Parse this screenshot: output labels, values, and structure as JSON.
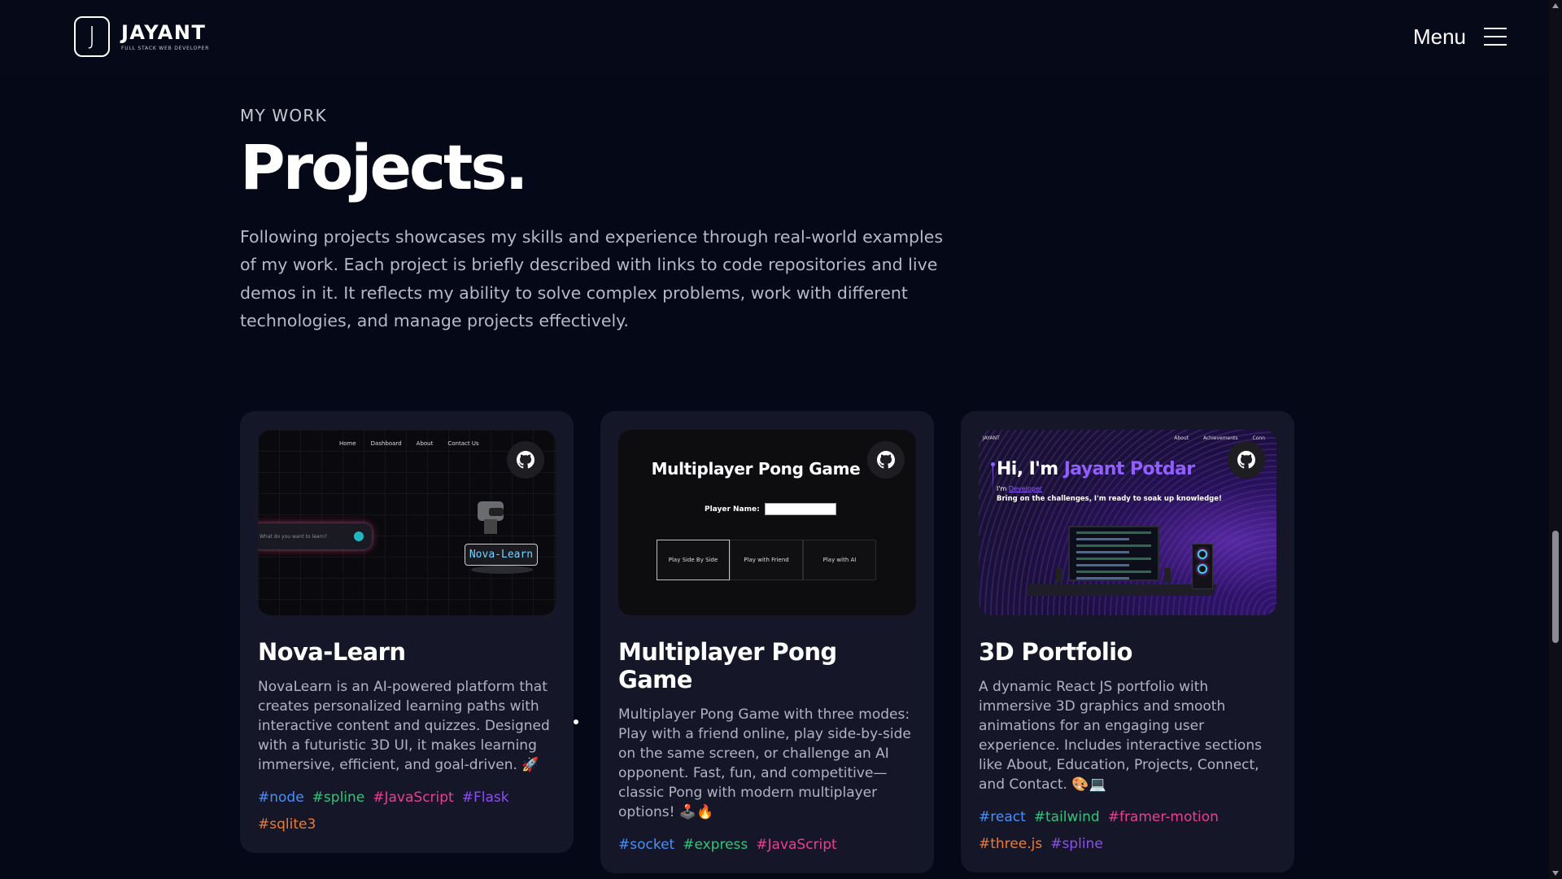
{
  "nav": {
    "logo_letter": "J",
    "brand_name": "JAYANT",
    "brand_tagline": "Full Stack Web Developer",
    "menu_label": "Menu"
  },
  "section": {
    "subtitle": "MY WORK",
    "title": "Projects.",
    "intro": "Following projects showcases my skills and experience through real-world examples of my work. Each project is briefly described with links to code repositories and live demos in it. It reflects my ability to solve complex problems, work with different technologies, and manage projects effectively."
  },
  "projects": [
    {
      "name": "Nova-Learn",
      "description": "NovaLearn is an AI-powered platform that creates personalized learning paths with interactive content and quizzes. Designed with a futuristic 3D UI, it makes learning immersive, efficient, and goal-driven. 🚀",
      "tags": [
        {
          "label": "#node",
          "color": "#4a8ff7"
        },
        {
          "label": "#spline",
          "color": "#33c47a"
        },
        {
          "label": "#JavaScript",
          "color": "#e8408f"
        },
        {
          "label": "#Flask",
          "color": "#8c4ff0"
        },
        {
          "label": "#sqlite3",
          "color": "#f07a2e"
        }
      ],
      "preview": {
        "nav": [
          "Home",
          "Dashboard",
          "About",
          "Contact Us"
        ],
        "search_placeholder": "What do you want to learn?",
        "sign": "Nova-Learn"
      }
    },
    {
      "name": "Multiplayer Pong Game",
      "description": "Multiplayer Pong Game with three modes: Play with a friend online, play side-by-side on the same screen, or challenge an AI opponent. Fast, fun, and competitive—classic Pong with modern multiplayer options! 🕹️🔥",
      "tags": [
        {
          "label": "#socket",
          "color": "#4a8ff7"
        },
        {
          "label": "#express",
          "color": "#33c47a"
        },
        {
          "label": "#JavaScript",
          "color": "#e8408f"
        }
      ],
      "preview": {
        "title": "Multiplayer Pong Game",
        "player_label": "Player Name:",
        "modes": [
          "Play Side By Side",
          "Play with Friend",
          "Play with AI"
        ]
      }
    },
    {
      "name": "3D Portfolio",
      "description": "A dynamic React JS portfolio with immersive 3D graphics and smooth animations for an engaging user experience. Includes interactive sections like About, Education, Projects, Connect, and Contact. 🎨💻",
      "tags": [
        {
          "label": "#react",
          "color": "#4a8ff7"
        },
        {
          "label": "#tailwind",
          "color": "#33c47a"
        },
        {
          "label": "#framer-motion",
          "color": "#e8408f"
        },
        {
          "label": "#three.js",
          "color": "#f07a2e"
        },
        {
          "label": "#spline",
          "color": "#8c4ff0"
        }
      ],
      "preview": {
        "nav_left": "JAYANT",
        "nav": [
          "About",
          "Achievements",
          "Conn"
        ],
        "hi_prefix": "Hi, I'm ",
        "hi_name": "Jayant Potdar",
        "line1_prefix": "I'm ",
        "line1_role": "Developer",
        "line2": "Bring on the challenges, I'm ready to soak up knowledge!"
      }
    }
  ],
  "icons": {
    "github": "github-icon",
    "hamburger": "hamburger-icon"
  }
}
